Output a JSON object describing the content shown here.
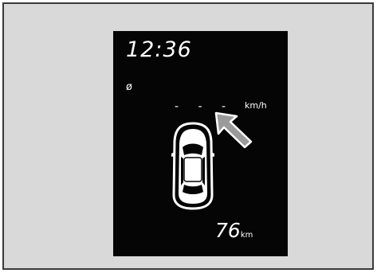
{
  "display": {
    "clock": "12:36",
    "symbol": "ø",
    "speed_readout": "- - -",
    "speed_unit": "km/h",
    "range_value": "76",
    "range_unit": "km"
  },
  "icons": {
    "car": "car-top-view-icon",
    "arrow": "pointer-arrow-icon"
  },
  "colors": {
    "frame_background": "#d9d9d9",
    "display_background": "#050505",
    "display_text": "#ffffff",
    "arrow_fill": "#9a9a9a"
  }
}
